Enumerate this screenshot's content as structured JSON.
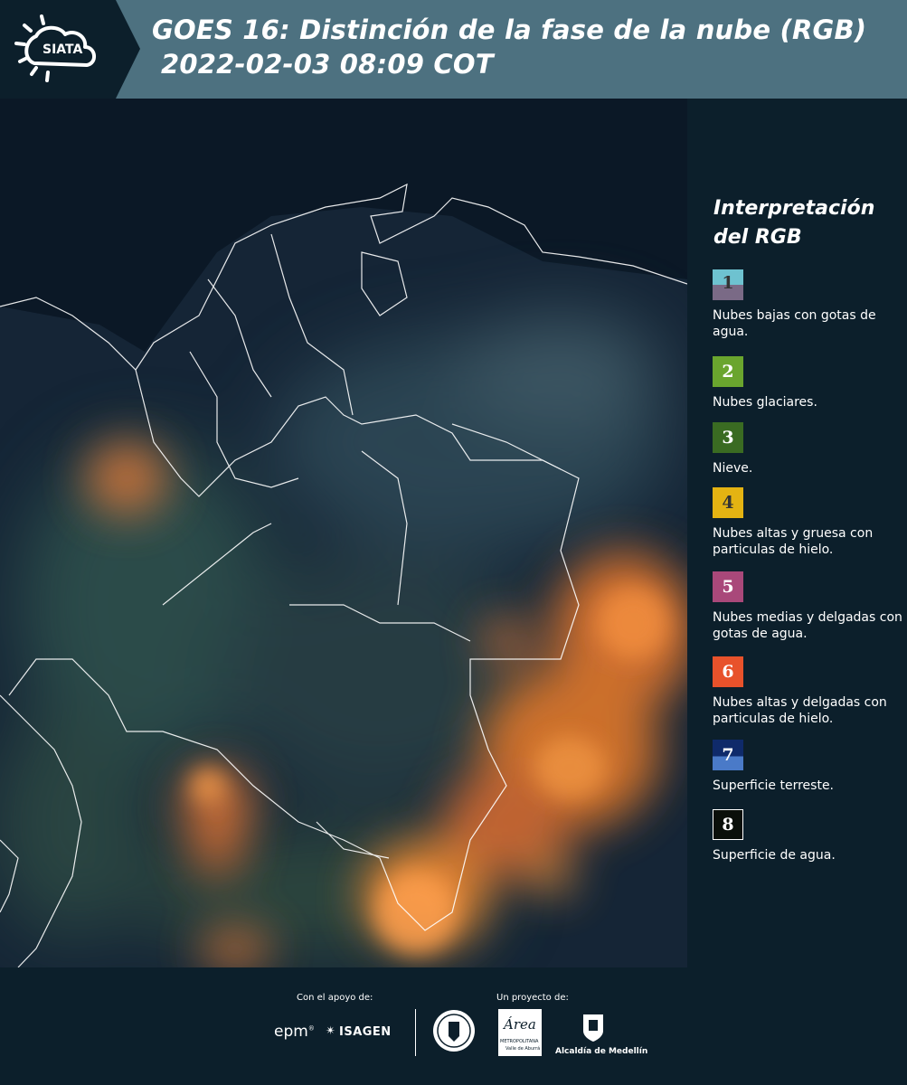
{
  "header": {
    "logo_text": "SIATA",
    "title_line1": "GOES 16: Distinción de la fase de la nube (RGB)",
    "title_line2": "2022-02-03 08:09 COT"
  },
  "legend": {
    "title": "Interpretación del RGB",
    "items": [
      {
        "number": "1",
        "label": "Nubes bajas con gotas de agua.",
        "color_top": "#6ec2d0",
        "color_bottom": "#7a6a86"
      },
      {
        "number": "2",
        "label": "Nubes glaciares.",
        "color": "#6aa52e"
      },
      {
        "number": "3",
        "label": "Nieve.",
        "color": "#3a6b22"
      },
      {
        "number": "4",
        "label": "Nubes altas y gruesa con particulas de hielo.",
        "color": "#e4b312"
      },
      {
        "number": "5",
        "label": "Nubes medias y delgadas con gotas de agua.",
        "color": "#a9487a"
      },
      {
        "number": "6",
        "label": "Nubes altas y delgadas con particulas de hielo.",
        "color": "#e8522b"
      },
      {
        "number": "7",
        "label": "Superficie terreste.",
        "color_top": "#0f2a6a",
        "color_bottom": "#4a7ac8"
      },
      {
        "number": "8",
        "label": "Superficie de agua.",
        "color": "#0a0f0a"
      }
    ]
  },
  "footer": {
    "support_label": "Con el apoyo de:",
    "project_label": "Un proyecto de:",
    "epm": "epm",
    "isagen": "ISAGEN",
    "area_text": "Área",
    "area_sub1": "METROPOLITANA",
    "area_sub2": "Valle de Aburrá",
    "alcaldia": "Alcaldía de Medellín"
  }
}
